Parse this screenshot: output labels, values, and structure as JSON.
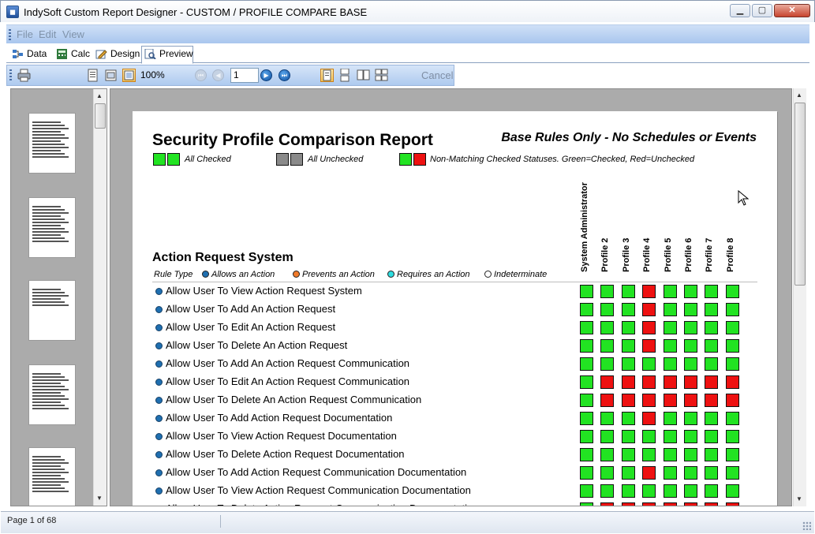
{
  "window": {
    "title": "IndySoft Custom Report Designer - CUSTOM / PROFILE COMPARE BASE",
    "icon_text": "Ĝ",
    "controls": [
      "minimize",
      "maximize",
      "close"
    ]
  },
  "menu": {
    "items": [
      "File",
      "Edit",
      "View"
    ]
  },
  "tabs": [
    {
      "label": "Data",
      "icon": "data-icon"
    },
    {
      "label": "Calc",
      "icon": "calc-icon"
    },
    {
      "label": "Design",
      "icon": "design-icon"
    },
    {
      "label": "Preview",
      "icon": "preview-icon",
      "active": true
    }
  ],
  "toolbar": {
    "zoom": "100%",
    "page": "1",
    "cancel_label": "Cancel"
  },
  "report": {
    "title": "Security Profile Comparison Report",
    "subtitle": "Base Rules Only - No Schedules or Events",
    "legend": {
      "all_checked": "All Checked",
      "all_unchecked": "All Unchecked",
      "non_matching": "Non-Matching Checked Statuses. Green=Checked, Red=Unchecked"
    },
    "section_title": "Action Request System",
    "rule_type": {
      "label": "Rule Type",
      "allows": "Allows an Action",
      "prevents": "Prevents an Action",
      "requires": "Requires an Action",
      "indeterminate": "Indeterminate"
    },
    "colors": {
      "checked": "#22e322",
      "unchecked": "#ee1111",
      "neutral": "#8a8a8a",
      "allows": "#1f6fb0",
      "prevents": "#f07a2a",
      "requires": "#2fdde0"
    },
    "profiles": [
      "System Administrator",
      "Profile 2",
      "Profile 3",
      "Profile 4",
      "Profile 5",
      "Profile 6",
      "Profile 7",
      "Profile 8"
    ],
    "rules": [
      {
        "label": "Allow User To View Action Request System",
        "status": "GGGRGGGG"
      },
      {
        "label": "Allow User To Add An Action Request",
        "status": "GGGRGGGG"
      },
      {
        "label": "Allow User To Edit An Action Request",
        "status": "GGGRGGGG"
      },
      {
        "label": "Allow User To Delete An Action Request",
        "status": "GGGRGGGG"
      },
      {
        "label": "Allow User To Add An Action Request Communication",
        "status": "GGGGGGGG"
      },
      {
        "label": "Allow User To Edit An Action Request Communication",
        "status": "GRRRRRRR"
      },
      {
        "label": "Allow User To Delete An Action Request Communication",
        "status": "GRRRRRRR"
      },
      {
        "label": "Allow User To Add Action Request Documentation",
        "status": "GGGRGGGG"
      },
      {
        "label": "Allow User To View Action Request Documentation",
        "status": "GGGGGGGG"
      },
      {
        "label": "Allow User To Delete Action Request Documentation",
        "status": "GGGGGGGG"
      },
      {
        "label": "Allow User To Add Action Request Communication Documentation",
        "status": "GGGRGGGG"
      },
      {
        "label": "Allow User To View Action Request Communication Documentation",
        "status": "GGGGGGGG"
      },
      {
        "label": "Allow User To Delete Action Request Communication Documentation",
        "status": "GRRRRRRR"
      }
    ]
  },
  "thumbnails_count": 5,
  "status": {
    "page_text": "Page 1 of 68"
  }
}
